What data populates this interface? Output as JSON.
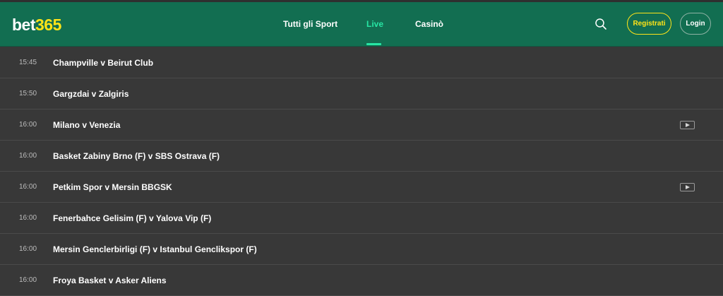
{
  "header": {
    "logo": {
      "part_a": "bet",
      "part_b": "365"
    },
    "nav": [
      "Tutti gli Sport",
      "Live",
      "Casinò"
    ],
    "active_nav": "Live",
    "register_label": "Registrati",
    "login_label": "Login",
    "search_icon": "search-icon"
  },
  "colors": {
    "header_bg": "#126e51",
    "accent": "#27e6a4",
    "brand_yellow": "#ffe418",
    "list_bg": "#383838"
  },
  "matches": [
    {
      "time": "15:45",
      "name": "Champville v Beirut Club",
      "video": false
    },
    {
      "time": "15:50",
      "name": "Gargzdai v Zalgiris",
      "video": false
    },
    {
      "time": "16:00",
      "name": "Milano v Venezia",
      "video": true
    },
    {
      "time": "16:00",
      "name": "Basket Zabiny Brno (F) v SBS Ostrava (F)",
      "video": false
    },
    {
      "time": "16:00",
      "name": "Petkim Spor v Mersin BBGSK",
      "video": true
    },
    {
      "time": "16:00",
      "name": "Fenerbahce Gelisim (F) v Yalova Vip (F)",
      "video": false
    },
    {
      "time": "16:00",
      "name": "Mersin Genclerbirligi (F) v Istanbul Genclikspor (F)",
      "video": false
    },
    {
      "time": "16:00",
      "name": "Froya Basket v Asker Aliens",
      "video": false
    }
  ]
}
